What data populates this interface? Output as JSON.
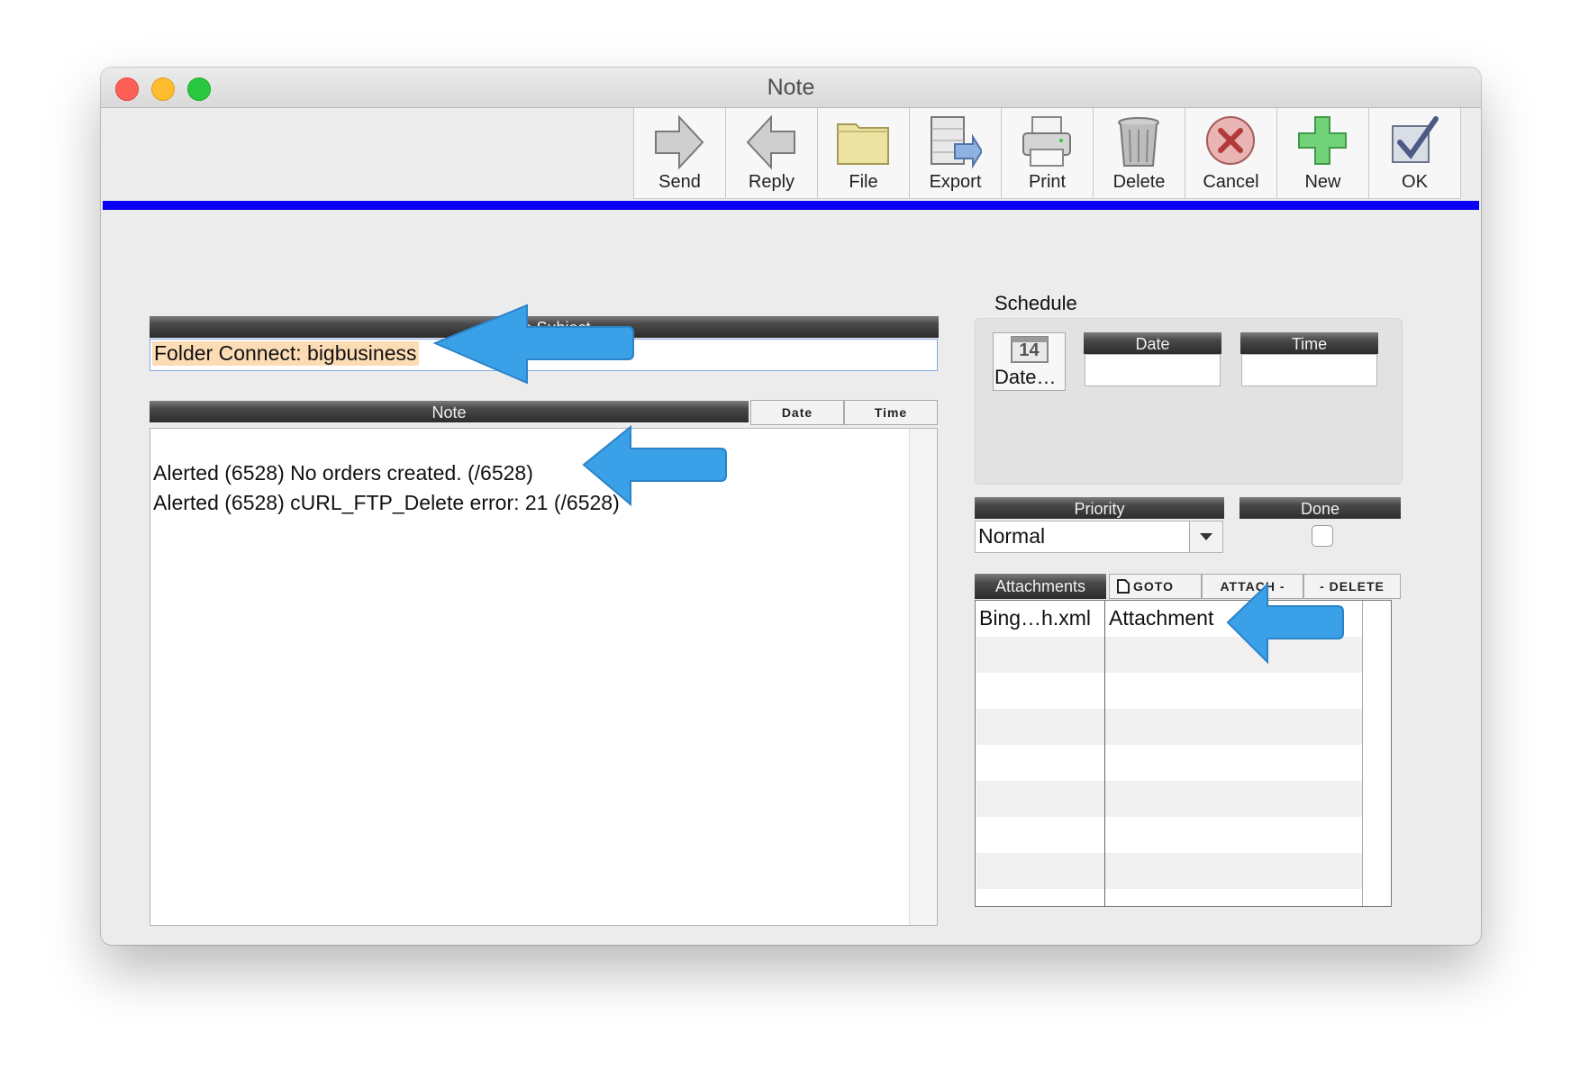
{
  "window": {
    "title": "Note"
  },
  "toolbar": {
    "buttons": [
      {
        "label": "Send",
        "icon": "arrow-right-icon"
      },
      {
        "label": "Reply",
        "icon": "arrow-left-icon"
      },
      {
        "label": "File",
        "icon": "folder-icon"
      },
      {
        "label": "Export",
        "icon": "export-icon"
      },
      {
        "label": "Print",
        "icon": "printer-icon"
      },
      {
        "label": "Delete",
        "icon": "trash-icon"
      },
      {
        "label": "Cancel",
        "icon": "cancel-icon"
      },
      {
        "label": "New",
        "icon": "plus-icon"
      },
      {
        "label": "OK",
        "icon": "checkmark-icon"
      }
    ],
    "accent_color": "#0a00f5"
  },
  "subject": {
    "header": "Note Subject",
    "value": "Folder Connect: bigbusiness",
    "highlight_color": "#fcdcb5"
  },
  "note": {
    "header": "Note",
    "date_button": "Date",
    "time_button": "Time",
    "lines": [
      "Alerted (6528) No orders created. (/6528)",
      "Alerted (6528) cURL_FTP_Delete error: 21 (/6528)"
    ]
  },
  "schedule": {
    "title": "Schedule",
    "calendar_day": "14",
    "date_button": "Date…",
    "date_header": "Date",
    "time_header": "Time",
    "date_value": "",
    "time_value": ""
  },
  "priority": {
    "header": "Priority",
    "value": "Normal"
  },
  "done": {
    "header": "Done",
    "checked": false
  },
  "attachments": {
    "header": "Attachments",
    "goto": "GOTO",
    "attach": "ATTACH -",
    "delete": "- DELETE",
    "rows": [
      {
        "file": "Bing…h.xml",
        "type": "Attachment"
      }
    ]
  },
  "annotation_color": "#3aa0e8"
}
